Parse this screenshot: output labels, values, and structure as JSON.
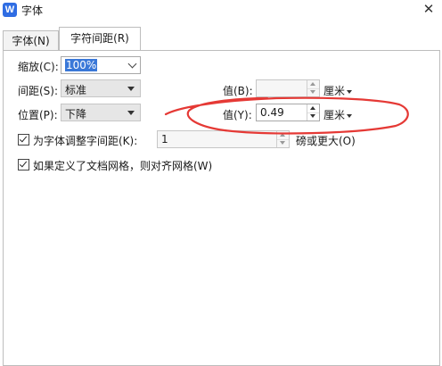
{
  "window": {
    "title": "字体",
    "app_icon": "W"
  },
  "tabs": [
    {
      "label": "字体(N)",
      "active": false
    },
    {
      "label": "字符间距(R)",
      "active": true
    }
  ],
  "scale": {
    "label": "缩放(C):",
    "value": "100%"
  },
  "spacing": {
    "label": "间距(S):",
    "value": "标准",
    "amount_label": "值(B):",
    "amount_value": "",
    "unit": "厘米"
  },
  "position": {
    "label": "位置(P):",
    "value": "下降",
    "amount_label": "值(Y):",
    "amount_value": "0.49",
    "unit": "厘米"
  },
  "kerning": {
    "checked": true,
    "label": "为字体调整字间距(K):",
    "value": "1",
    "suffix": "磅或更大(O)"
  },
  "grid": {
    "checked": true,
    "label": "如果定义了文档网格，则对齐网格(W)"
  },
  "annotation": {
    "color": "#e53935"
  },
  "colors": {
    "accent": "#3a78d8",
    "icon": "#2f6de3"
  }
}
